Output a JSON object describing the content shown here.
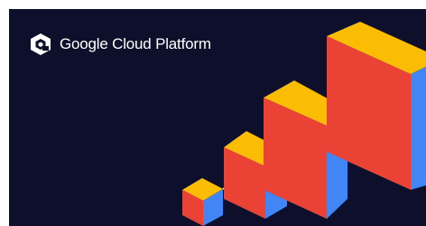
{
  "banner": {
    "logo": {
      "icon": "google-cloud-hexagon-icon",
      "brand_text": "Google Cloud Platform"
    },
    "colors": {
      "background": "#0d0f2b",
      "cube_front": "#ea4335",
      "cube_top": "#fbbc04",
      "cube_side": "#4285f4",
      "connector": "#ffffff"
    }
  }
}
